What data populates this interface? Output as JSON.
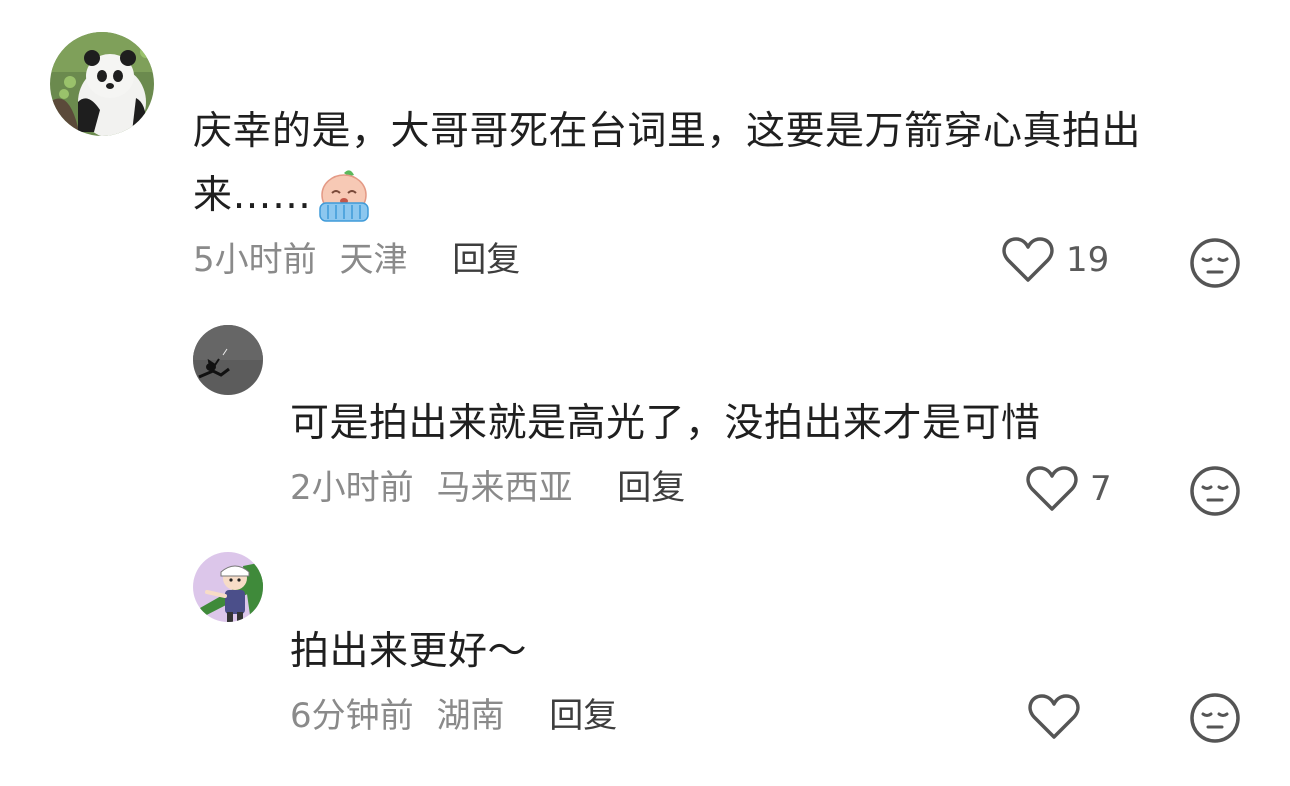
{
  "comments": [
    {
      "text_line1": "庆幸的是，大哥哥死在台词里，这要是万箭穿心真拍出",
      "text_line2": "来……",
      "time": "5小时前",
      "location": "天津",
      "reply_label": "回复",
      "like_count": "19",
      "avatar_icon": "panda-avatar",
      "emoji_icon": "crying-emoji-icon"
    },
    {
      "text": "可是拍出来就是高光了，没拍出来才是可惜",
      "time": "2小时前",
      "location": "马来西亚",
      "reply_label": "回复",
      "like_count": "7",
      "avatar_icon": "bird-branch-avatar"
    },
    {
      "text": "拍出来更好～",
      "time": "6分钟前",
      "location": "湖南",
      "reply_label": "回复",
      "like_count": "",
      "avatar_icon": "cartoon-character-avatar"
    }
  ],
  "colors": {
    "text": "#1f1f1f",
    "meta": "#8a8a8a",
    "reply": "#3d3d3d",
    "icon": "#555555"
  }
}
